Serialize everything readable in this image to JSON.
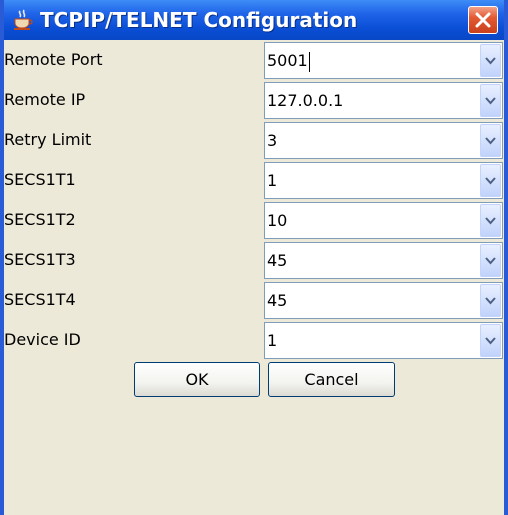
{
  "window": {
    "title": "TCPIP/TELNET Configuration",
    "icon": "java-cup-icon",
    "close_icon": "close-icon"
  },
  "fields": [
    {
      "label": "Remote Port",
      "value": "5001",
      "focused": true
    },
    {
      "label": "Remote IP",
      "value": "127.0.0.1"
    },
    {
      "label": "Retry Limit",
      "value": "3"
    },
    {
      "label": "SECS1T1",
      "value": "1"
    },
    {
      "label": "SECS1T2",
      "value": "10"
    },
    {
      "label": "SECS1T3",
      "value": "45"
    },
    {
      "label": "SECS1T4",
      "value": "45"
    },
    {
      "label": "Device ID",
      "value": "1"
    }
  ],
  "buttons": {
    "ok_label": "OK",
    "cancel_label": "Cancel"
  },
  "colors": {
    "title_bar": "#0a4fd6",
    "close_button": "#e35b34",
    "dialog_background": "#ece9d8",
    "field_border": "#7f9db9"
  }
}
